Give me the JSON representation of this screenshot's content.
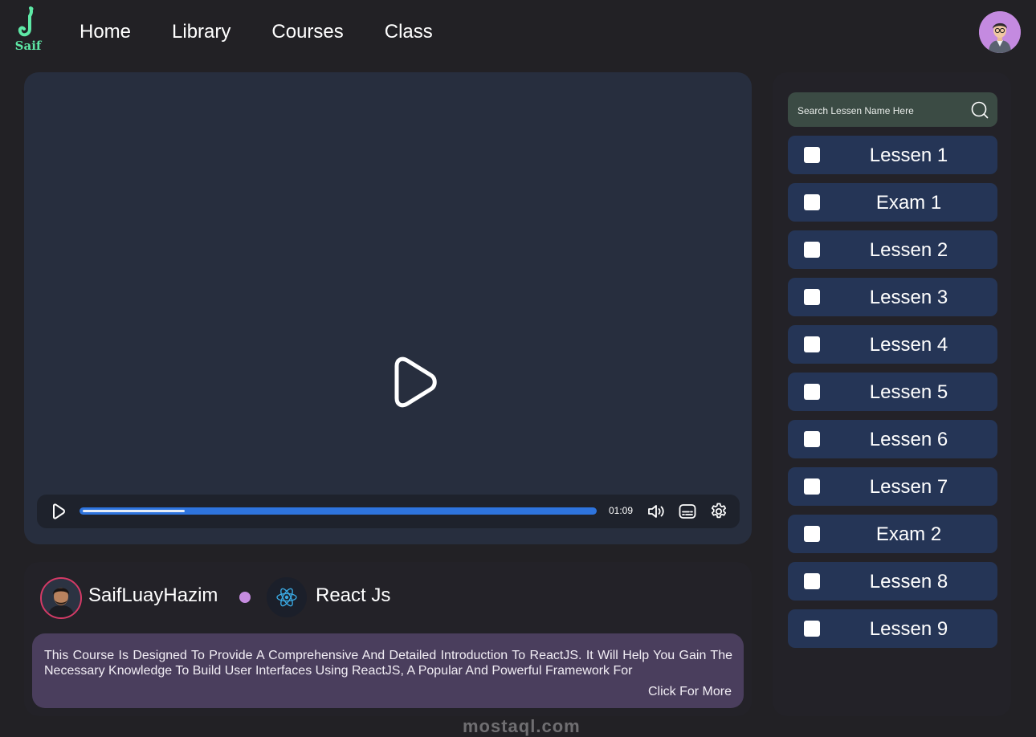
{
  "header": {
    "logo_text": "Saif",
    "nav": [
      "Home",
      "Library",
      "Courses",
      "Class"
    ]
  },
  "player": {
    "time": "01:09",
    "progress": 0.2
  },
  "info": {
    "instructor": "SaifLuayHazim",
    "course": "React Js",
    "description": "This Course Is Designed To Provide A Comprehensive And Detailed Introduction To ReactJS. It Will Help You Gain The Necessary Knowledge To Build User Interfaces Using ReactJS, A Popular And Powerful Framework For",
    "click_more": "Click For More",
    "watermark": "mostaql.com"
  },
  "sidebar": {
    "search_placeholder": "Search Lessen Name Here",
    "lessons": [
      "Lessen 1",
      "Exam 1",
      "Lessen 2",
      "Lessen 3",
      "Lessen 4",
      "Lessen 5",
      "Lessen 6",
      "Lessen 7",
      "Exam 2",
      "Lessen 8",
      "Lessen 9"
    ]
  },
  "colors": {
    "background": "#222125",
    "player": "#272e3e",
    "progress": "#2e74de",
    "lesson_item": "#253556",
    "search_bg": "#3b4b44",
    "description_bg": "#4a3e5d",
    "accent_dot": "#c68ce0",
    "logo": "#5ee8a6"
  }
}
